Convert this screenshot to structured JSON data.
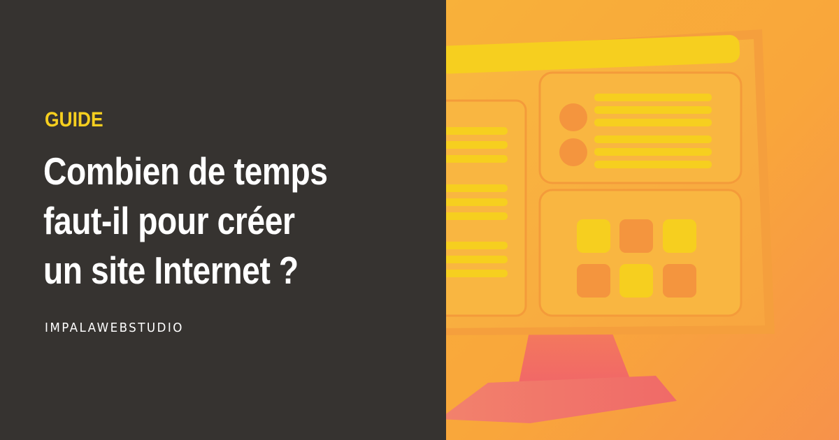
{
  "category": {
    "label": "GUIDE",
    "color": "#f6cf1f"
  },
  "headline": {
    "lines": [
      "Combien de temps",
      "faut-il pour créer",
      "un site Internet ?"
    ]
  },
  "brand": {
    "logo_text": "IMPALAWEBSTUDIO"
  },
  "colors": {
    "panel_background": "#363330",
    "illustration_background": "#f9a63b",
    "accent_yellow": "#f6cf1f",
    "accent_pink": "#f2706a"
  }
}
